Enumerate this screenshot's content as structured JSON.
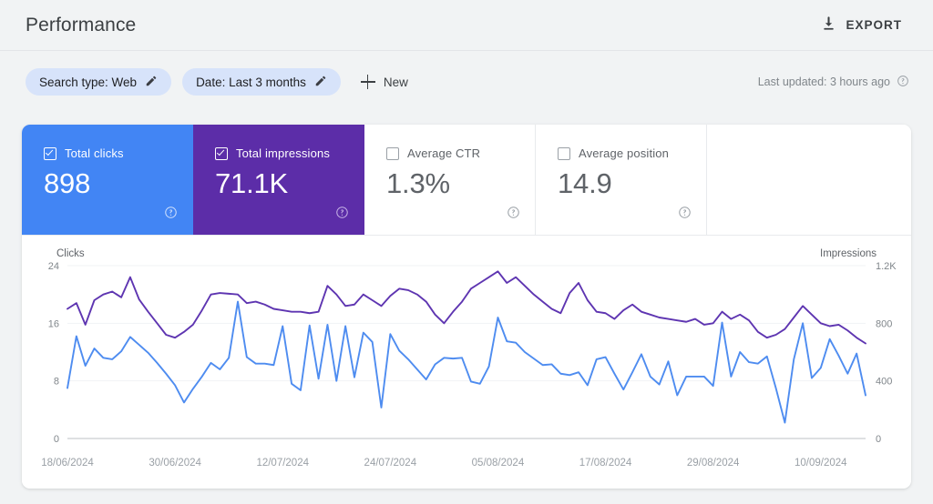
{
  "header": {
    "title": "Performance",
    "export_label": "EXPORT",
    "export_icon": "download-icon"
  },
  "filters": {
    "chips": [
      {
        "label": "Search type: Web",
        "icon": "pencil-icon"
      },
      {
        "label": "Date: Last 3 months",
        "icon": "pencil-icon"
      }
    ],
    "new_label": "New",
    "new_icon": "plus-icon",
    "last_updated": "Last updated: 3 hours ago",
    "help_icon": "help-circle-icon"
  },
  "metrics": [
    {
      "label": "Total clicks",
      "value": "898",
      "selected": true,
      "color": "#4285f4",
      "help_icon": "help-circle-icon"
    },
    {
      "label": "Total impressions",
      "value": "71.1K",
      "selected": true,
      "color": "#5c2da8",
      "help_icon": "help-circle-icon"
    },
    {
      "label": "Average CTR",
      "value": "1.3%",
      "selected": false,
      "color": "#ffffff",
      "help_icon": "help-circle-icon"
    },
    {
      "label": "Average position",
      "value": "14.9",
      "selected": false,
      "color": "#ffffff",
      "help_icon": "help-circle-icon"
    }
  ],
  "chart_data": {
    "type": "line",
    "title": "",
    "xlabel": "",
    "ylabel": "Clicks",
    "y2label": "Impressions",
    "grid": true,
    "legend": "none",
    "ylim": [
      0,
      24
    ],
    "y2lim": [
      0,
      1200
    ],
    "yticks": [
      0,
      8,
      16,
      24
    ],
    "ytick_labels": [
      "0",
      "8",
      "16",
      "24"
    ],
    "y2ticks": [
      0,
      400,
      800,
      1200
    ],
    "y2tick_labels": [
      "0",
      "400",
      "800",
      "1.2K"
    ],
    "x_start": "18/06/2024",
    "x_end": "15/09/2024",
    "xtick_labels": [
      "18/06/2024",
      "30/06/2024",
      "12/07/2024",
      "24/07/2024",
      "05/08/2024",
      "17/08/2024",
      "29/08/2024",
      "10/09/2024"
    ],
    "xtick_indices": [
      0,
      12,
      24,
      36,
      48,
      60,
      72,
      84
    ],
    "series": [
      {
        "name": "Total clicks",
        "color": "#4e8cf0",
        "axis": "left",
        "values": [
          7.0,
          14.2,
          10.1,
          12.5,
          11.2,
          11.0,
          12.1,
          14.1,
          13.0,
          11.9,
          10.5,
          9.0,
          7.4,
          5.0,
          6.9,
          8.6,
          10.5,
          9.6,
          11.2,
          19.0,
          11.3,
          10.4,
          10.4,
          10.2,
          15.6,
          7.6,
          6.7,
          15.7,
          8.3,
          15.8,
          8.0,
          15.6,
          8.5,
          14.7,
          13.4,
          4.3,
          14.5,
          12.2,
          11.0,
          9.6,
          8.2,
          10.3,
          11.2,
          11.1,
          11.2,
          7.9,
          7.6,
          10.0,
          16.8,
          13.5,
          13.3,
          12.0,
          11.1,
          10.2,
          10.3,
          9.0,
          8.8,
          9.2,
          7.4,
          11.0,
          11.3,
          9.0,
          6.8,
          9.2,
          11.7,
          8.6,
          7.5,
          10.7,
          6.0,
          8.6,
          8.6,
          8.6,
          7.3,
          16.1,
          8.6,
          12.0,
          10.6,
          10.4,
          11.4,
          7.0,
          2.2,
          11.0,
          16.0,
          8.4,
          9.8,
          13.8,
          11.5,
          9.0,
          11.8,
          6.0
        ]
      },
      {
        "name": "Total impressions",
        "color": "#5e35b1",
        "axis": "right",
        "values": [
          900,
          940,
          790,
          960,
          1000,
          1020,
          980,
          1120,
          965,
          880,
          800,
          720,
          700,
          740,
          790,
          890,
          1000,
          1010,
          1005,
          1000,
          940,
          950,
          930,
          900,
          890,
          880,
          880,
          870,
          880,
          1060,
          1000,
          920,
          930,
          1000,
          960,
          920,
          990,
          1040,
          1030,
          1000,
          950,
          860,
          800,
          880,
          950,
          1040,
          1080,
          1120,
          1160,
          1080,
          1120,
          1060,
          1000,
          950,
          900,
          870,
          1010,
          1080,
          960,
          880,
          870,
          830,
          890,
          930,
          880,
          860,
          840,
          830,
          820,
          810,
          830,
          790,
          800,
          880,
          830,
          860,
          820,
          740,
          700,
          720,
          760,
          840,
          920,
          860,
          800,
          780,
          790,
          750,
          700,
          660
        ]
      }
    ]
  }
}
